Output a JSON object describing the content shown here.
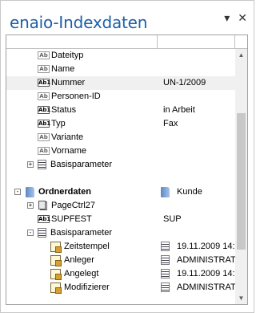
{
  "window": {
    "title": "enaio-Indexdaten",
    "dropdown_glyph": "▾",
    "close_glyph": "✕"
  },
  "rows": [
    {
      "label": "Dateityp",
      "value": "",
      "icon": "Ab"
    },
    {
      "label": "Name",
      "value": "",
      "icon": "Ab"
    },
    {
      "label": "Nummer",
      "value": "UN-1/2009",
      "icon": "Ab1"
    },
    {
      "label": "Personen-ID",
      "value": "",
      "icon": "Ab"
    },
    {
      "label": "Status",
      "value": "in Arbeit",
      "icon": "Ab1"
    },
    {
      "label": "Typ",
      "value": "Fax",
      "icon": "Ab1"
    },
    {
      "label": "Variante",
      "value": "",
      "icon": "Ab"
    },
    {
      "label": "Vorname",
      "value": "",
      "icon": "Ab"
    },
    {
      "label": "Basisparameter",
      "expander": "+"
    },
    {
      "label": "Ordnerdaten",
      "value": "Kunde",
      "expander": "-"
    },
    {
      "label": "PageCtrl27",
      "value": ""
    },
    {
      "label": "SUPFEST",
      "value": "SUP",
      "icon": "Ab1"
    },
    {
      "label": "Basisparameter",
      "expander": "-"
    },
    {
      "label": "Zeitstempel",
      "value": "19.11.2009 14:"
    },
    {
      "label": "Anleger",
      "value": "ADMINISTRAT"
    },
    {
      "label": "Angelegt",
      "value": "19.11.2009 14:"
    },
    {
      "label": "Modifizierer",
      "value": "ADMINISTRAT"
    }
  ],
  "scrollbar": {
    "up": "▲",
    "down": "▼"
  }
}
